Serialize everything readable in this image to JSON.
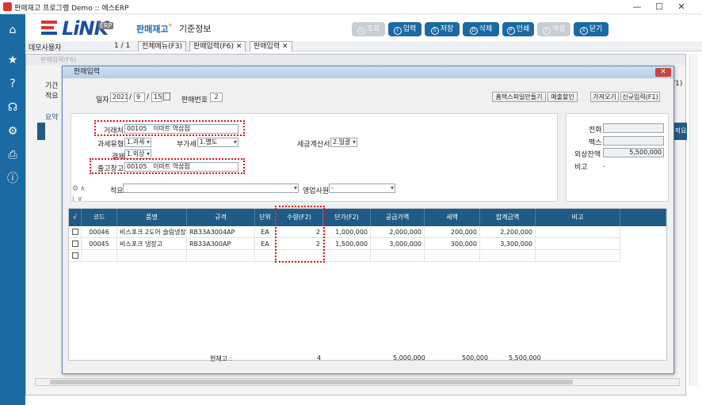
{
  "window": {
    "title": "판매재고 프로그램 Demo :: 에스ERP",
    "min": "—",
    "max": "☐",
    "close": "✕"
  },
  "header": {
    "logo": "LiNK",
    "logo_badge": "ERP",
    "menu1": "판매재고",
    "menu1_dot": "*",
    "menu2": "기준정보"
  },
  "toolbar": [
    {
      "icon": "◎",
      "label": "조회",
      "disabled": true
    },
    {
      "icon": "I",
      "label": "입력",
      "disabled": false
    },
    {
      "icon": "S",
      "label": "저장",
      "disabled": false
    },
    {
      "icon": "D",
      "label": "삭제",
      "disabled": false
    },
    {
      "icon": "P",
      "label": "인쇄",
      "disabled": false
    },
    {
      "icon": "E",
      "label": "엑셀",
      "disabled": true
    },
    {
      "icon": "X",
      "label": "닫기",
      "disabled": false
    }
  ],
  "tabbar": {
    "user": "데모사용자",
    "page": "1 / 1",
    "tabs": [
      "전체메뉴(F3)",
      "판매입력(F6)",
      "판매입력"
    ]
  },
  "background": {
    "title": "판매입력(F6)",
    "label_period": "기간",
    "label_summary": "적요",
    "tab": "요약",
    "btn_f1": "F1)",
    "col_summary": "적요"
  },
  "dialog": {
    "title": "판매입력",
    "close": "✕",
    "date_label": "일자",
    "year": "2021",
    "month": "9",
    "day": "15",
    "saleno_label": "판매번호",
    "saleno": "2",
    "buttons": [
      "홈택스파일만들기",
      "매출할인",
      "가져오기",
      "신규입력(F1)"
    ],
    "customer_label": "거래처",
    "customer_code": "00105",
    "customer_name": "이마트 역삼점",
    "taxtype_label": "과세유형",
    "taxtype": "1.과세",
    "vat_label": "부가세",
    "vat": "1.별도",
    "invoice_label": "세금계산서",
    "invoice": "2.일괄",
    "payment_label": "결제",
    "payment": "1.외상",
    "warehouse_label": "출고창고",
    "warehouse_code": "00105",
    "warehouse_name": "이마트 역삼점",
    "summary_label": "적요",
    "summary": "",
    "sales_label": "영업사원",
    "sales": "-",
    "phone_label": "전화",
    "phone": "",
    "fax_label": "팩스",
    "fax": "",
    "credit_label": "외상잔액",
    "credit": "5,500,000",
    "note_label": "비고",
    "note": ".",
    "side_icons": [
      "⚙",
      "∧",
      "i",
      "∨"
    ]
  },
  "grid": {
    "headers": [
      "√",
      "코드",
      "품명",
      "규격",
      "단위",
      "수량(F2)",
      "단가(F2)",
      "공급가액",
      "세액",
      "합계금액",
      "비고"
    ],
    "rows": [
      {
        "code": "00046",
        "name": "비스포크 2도어 슬림냉장...",
        "spec": "RB33A3004AP",
        "unit": "EA",
        "qty": "2",
        "price": "1,000,000",
        "supply": "2,000,000",
        "tax": "200,000",
        "total": "2,200,000",
        "note": ""
      },
      {
        "code": "00045",
        "name": "비스포크 냉장고",
        "spec": "RB33A300AP",
        "unit": "EA",
        "qty": "2",
        "price": "1,500,000",
        "supply": "3,000,000",
        "tax": "300,000",
        "total": "3,300,000",
        "note": ""
      },
      {
        "code": "",
        "name": "",
        "spec": "",
        "unit": "",
        "qty": "",
        "price": "",
        "supply": "",
        "tax": "",
        "total": "",
        "note": ""
      }
    ],
    "footer": {
      "label": "현재고 :",
      "qty": "4",
      "supply": "5,000,000",
      "tax": "500,000",
      "total": "5,500,000"
    }
  },
  "colors": {
    "nav": "#1b6aa3",
    "grid_header": "#1f5b86",
    "highlight": "#e0101a"
  }
}
